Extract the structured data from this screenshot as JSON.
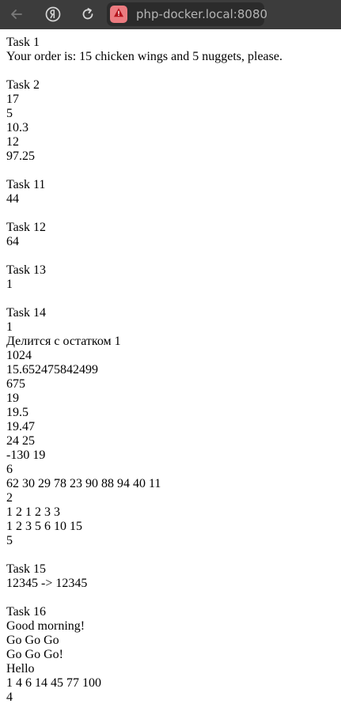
{
  "browser": {
    "url": "php-docker.local:8080",
    "back_icon": "arrow-left-icon",
    "yandex_icon": "yandex-logo-icon",
    "reload_icon": "reload-icon",
    "warning_icon": "warning-triangle-icon"
  },
  "tasks": [
    {
      "title": "Task 1",
      "lines": [
        "Your order is: 15 chicken wings and 5 nuggets, please."
      ]
    },
    {
      "title": "Task 2",
      "lines": [
        "17",
        "5",
        "10.3",
        "12",
        "97.25"
      ]
    },
    {
      "title": "Task 11",
      "lines": [
        "44"
      ]
    },
    {
      "title": "Task 12",
      "lines": [
        "64"
      ]
    },
    {
      "title": "Task 13",
      "lines": [
        "1"
      ]
    },
    {
      "title": "Task 14",
      "lines": [
        "1",
        "Делится с остатком 1",
        "1024",
        "15.652475842499",
        "675",
        "19",
        "19.5",
        "19.47",
        "24 25",
        "-130 19",
        "6",
        "62 30 29 78 23 90 88 94 40 11",
        "2",
        "1 2 1 2 3 3",
        "1 2 3 5 6 10 15",
        "5"
      ]
    },
    {
      "title": "Task 15",
      "lines": [
        "12345 -> 12345"
      ]
    },
    {
      "title": "Task 16",
      "lines": [
        "Good morning!",
        "Go Go Go",
        "Go Go Go!",
        "Hello",
        "1 4 6 14 45 77 100",
        "4"
      ]
    }
  ]
}
